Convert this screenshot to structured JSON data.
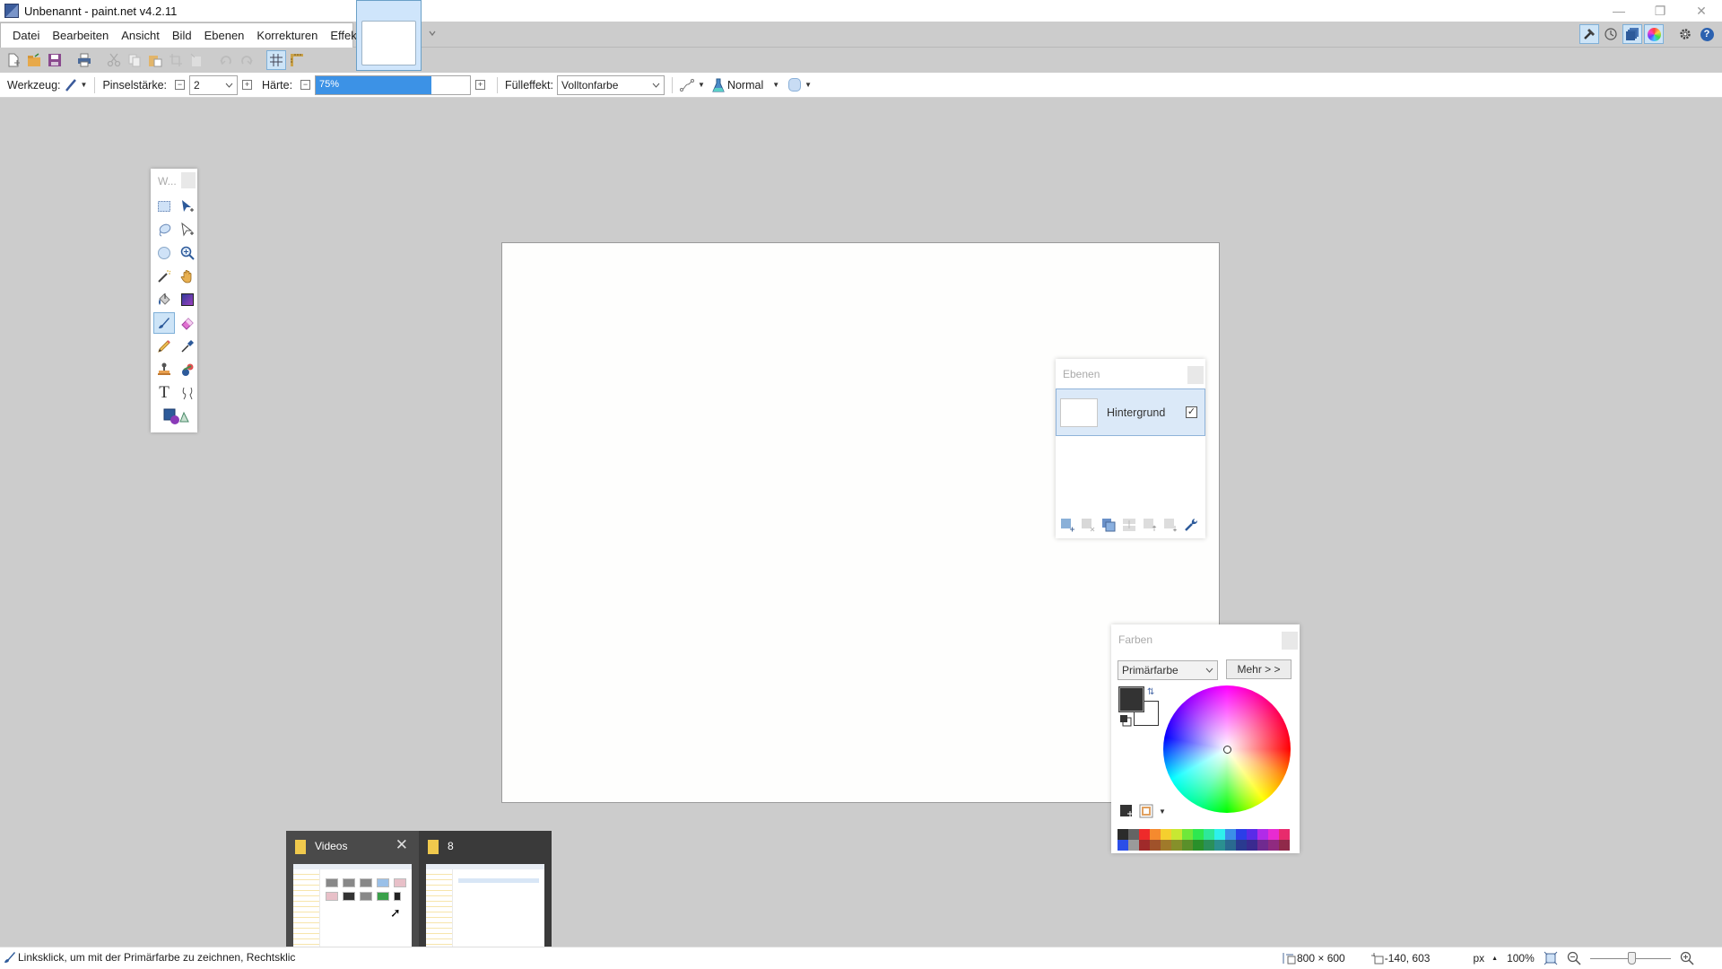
{
  "window": {
    "title": "Unbenannt - paint.net v4.2.11",
    "controls": {
      "minimize": "—",
      "restore": "❐",
      "close": "✕"
    }
  },
  "menu": {
    "items": [
      "Datei",
      "Bearbeiten",
      "Ansicht",
      "Bild",
      "Ebenen",
      "Korrekturen",
      "Effekte"
    ]
  },
  "toolbar": {
    "icons": [
      "new-icon",
      "open-icon",
      "save-icon",
      "print-icon",
      "cut-icon",
      "copy-icon",
      "paste-icon",
      "crop-icon",
      "deselect-icon",
      "undo-icon",
      "redo-icon",
      "grid-icon",
      "ruler-icon"
    ]
  },
  "top_right": {
    "icons": [
      "tools-window-icon",
      "history-icon",
      "layers-window-icon",
      "colors-window-icon",
      "settings-icon",
      "help-icon"
    ]
  },
  "options": {
    "tool_label": "Werkzeug:",
    "brush_width_label": "Pinselstärke:",
    "brush_width_value": "2",
    "hardness_label": "Härte:",
    "hardness_value": "75%",
    "hardness_percent": 75,
    "fill_label": "Fülleffekt:",
    "fill_value": "Volltonfarbe",
    "blend_mode": "Normal",
    "minus": "−",
    "plus": "+"
  },
  "tools_window": {
    "title": "W...",
    "active_tool": "paintbrush",
    "tools": [
      "rectangle-select",
      "move-selected-pixels",
      "lasso-select",
      "move-selection",
      "ellipse-select",
      "zoom",
      "magic-wand",
      "pan",
      "paint-bucket",
      "gradient",
      "paintbrush",
      "eraser",
      "pencil",
      "color-picker",
      "clone-stamp",
      "recolor",
      "text",
      "line-curve",
      "shapes"
    ]
  },
  "layers_window": {
    "title": "Ebenen",
    "layers": [
      {
        "name": "Hintergrund",
        "visible": true,
        "selected": true
      }
    ],
    "checkmark": "✓"
  },
  "colors_window": {
    "title": "Farben",
    "mode_select": "Primärfarbe",
    "more_button": "Mehr > >",
    "primary_color": "#333333",
    "secondary_color": "#ffffff",
    "palette_row1": [
      "#2b2b2b",
      "#646464",
      "#ee2a2a",
      "#f58a2e",
      "#f5cf2e",
      "#c8e832",
      "#6fe83a",
      "#2ee850",
      "#2ee89a",
      "#2ef0ec",
      "#3b8ee8",
      "#2b3ee8",
      "#5a2be8",
      "#b12be8",
      "#e82bd1",
      "#e82b6c"
    ],
    "palette_row2": [
      "#2b4ee8",
      "#9a9a9a",
      "#a02a2a",
      "#a0522a",
      "#a07a2a",
      "#86902a",
      "#5a902a",
      "#2a902a",
      "#2a905a",
      "#2a9090",
      "#2a6a90",
      "#2a3a90",
      "#3a2a90",
      "#702a90",
      "#902a80",
      "#902a4a"
    ]
  },
  "taskbar_preview": {
    "items": [
      {
        "title": "Videos",
        "close": "✕"
      },
      {
        "title": "8"
      }
    ]
  },
  "status": {
    "hint": "Linksklick, um mit der Primärfarbe zu zeichnen, Rechtsklic",
    "image_size": "800 × 600",
    "cursor_position": "-140, 603",
    "units": "px",
    "units_caret": "▲",
    "zoom": "100%"
  }
}
